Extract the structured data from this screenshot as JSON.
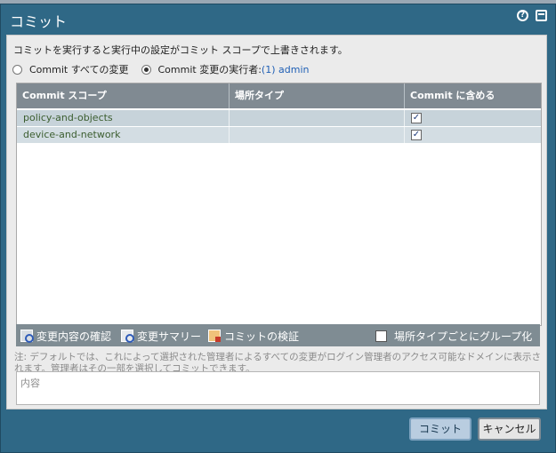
{
  "dialog": {
    "title": "コミット",
    "icons": [
      "help-icon",
      "maximize-icon"
    ]
  },
  "description": "コミットを実行すると実行中の設定がコミット スコープで上書きされます。",
  "options": {
    "all_changes": "Commit すべての変更",
    "by_user_prefix": "Commit 変更の実行者:",
    "by_user_link": "(1) admin",
    "selected": "by_user"
  },
  "table": {
    "headers": [
      "Commit スコープ",
      "場所タイプ",
      "Commit に含める"
    ],
    "rows": [
      {
        "scope": "policy-and-objects",
        "location": "",
        "include": true
      },
      {
        "scope": "device-and-network",
        "location": "",
        "include": true
      }
    ]
  },
  "toolbar": {
    "preview": "変更内容の確認",
    "summary": "変更サマリー",
    "validate": "コミットの検証",
    "group_by_location": "場所タイプごとにグループ化",
    "group_checked": false
  },
  "note": "注: デフォルトでは、これによって選択された管理者によるすべての変更がログイン管理者のアクセス可能なドメインに表示されます。管理者はその一部を選択してコミットできます。",
  "description_field": {
    "placeholder": "内容",
    "value": ""
  },
  "buttons": {
    "commit": "コミット",
    "cancel": "キャンセル"
  }
}
